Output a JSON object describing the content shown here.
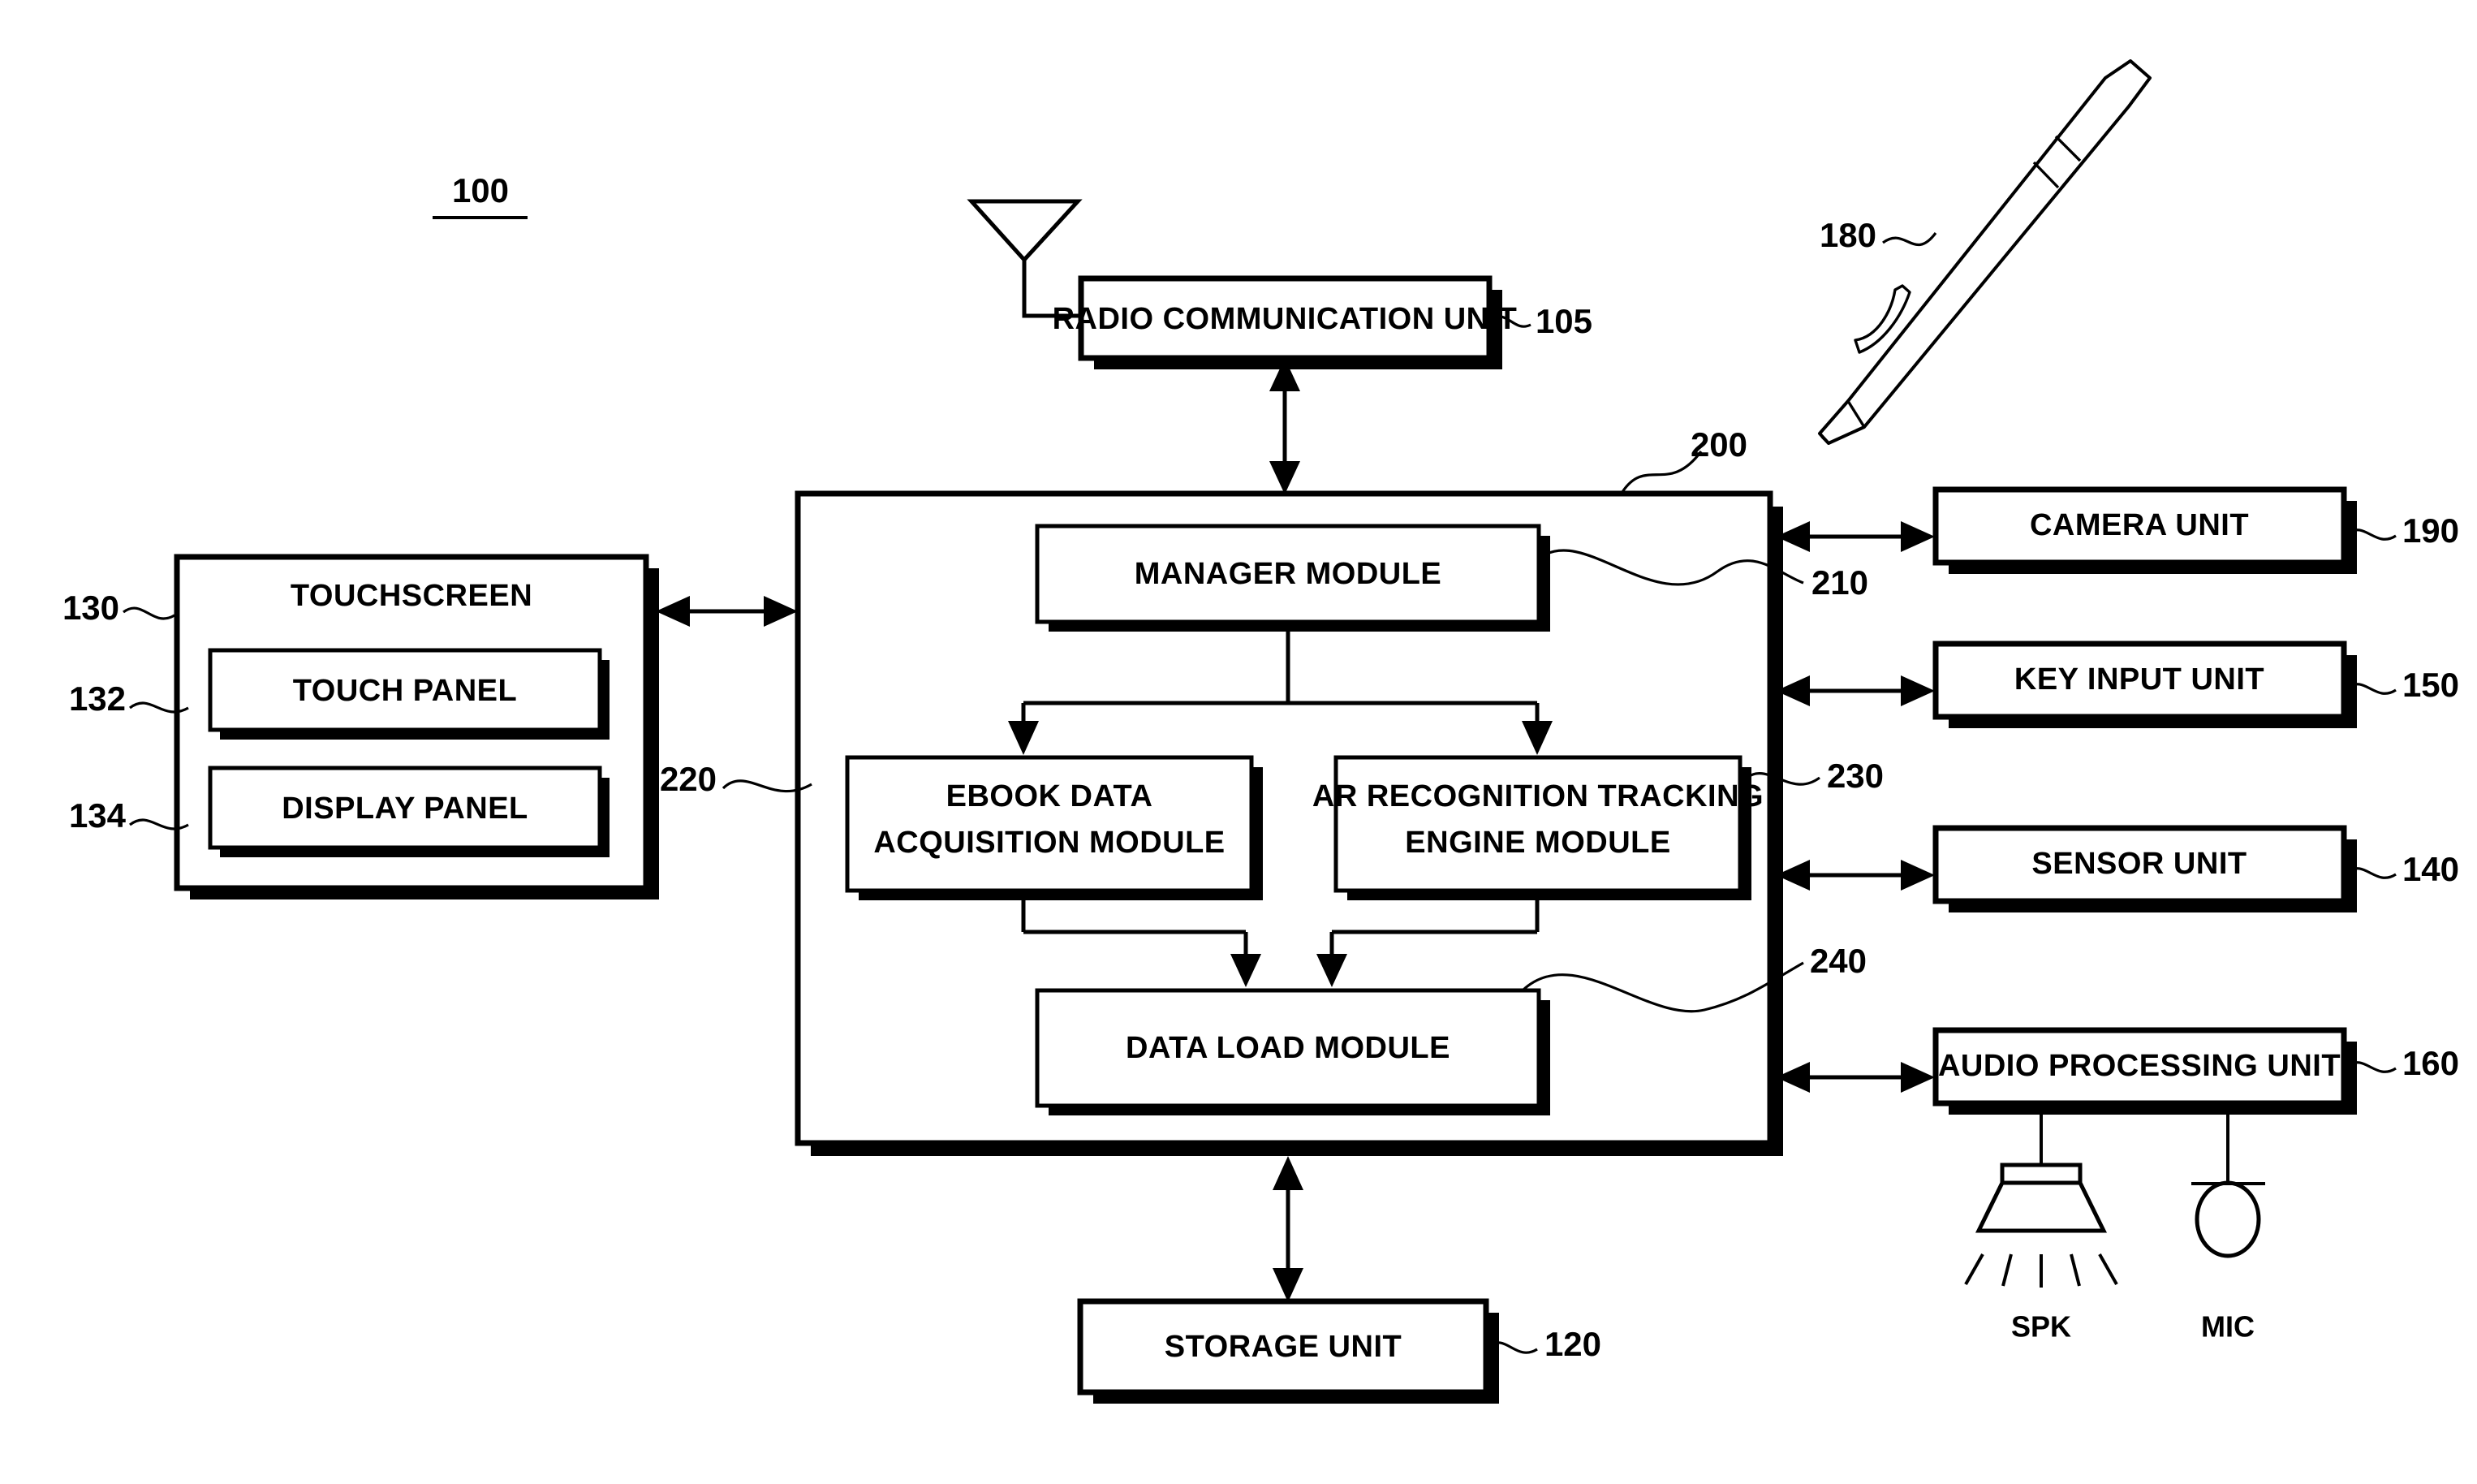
{
  "figure": {
    "title_label": "100",
    "title_underlined": true
  },
  "blocks": {
    "radio_communication_unit": {
      "label": "RADIO COMMUNICATION UNIT",
      "ref": "105"
    },
    "touchscreen": {
      "label": "TOUCHSCREEN",
      "ref": "130"
    },
    "touch_panel": {
      "label": "TOUCH PANEL",
      "ref": "132"
    },
    "display_panel": {
      "label": "DISPLAY PANEL",
      "ref": "134"
    },
    "control_unit": {
      "ref": "200"
    },
    "manager_module": {
      "label": "MANAGER MODULE",
      "ref": "210"
    },
    "ebook_data_acquisition_module": {
      "label_line1": "EBOOK DATA",
      "label_line2": "ACQUISITION MODULE",
      "ref": "220"
    },
    "ar_recognition_tracking_engine_module": {
      "label_line1": "AR RECOGNITION TRACKING",
      "label_line2": "ENGINE MODULE",
      "ref": "230"
    },
    "data_load_module": {
      "label": "DATA LOAD MODULE",
      "ref": "240"
    },
    "storage_unit": {
      "label": "STORAGE UNIT",
      "ref": "120"
    },
    "camera_unit": {
      "label": "CAMERA UNIT",
      "ref": "190"
    },
    "key_input_unit": {
      "label": "KEY INPUT UNIT",
      "ref": "150"
    },
    "sensor_unit": {
      "label": "SENSOR UNIT",
      "ref": "140"
    },
    "audio_processing_unit": {
      "label": "AUDIO PROCESSING UNIT",
      "ref": "160"
    }
  },
  "peripherals": {
    "speaker": {
      "label": "SPK",
      "icon": "speaker-icon"
    },
    "microphone": {
      "label": "MIC",
      "icon": "microphone-icon"
    },
    "antenna": {
      "icon": "antenna-icon"
    },
    "stylus_pen": {
      "ref": "180",
      "icon": "stylus-pen-icon"
    }
  },
  "colors": {
    "line": "#000000",
    "fill": "#ffffff",
    "background": "#ffffff"
  }
}
